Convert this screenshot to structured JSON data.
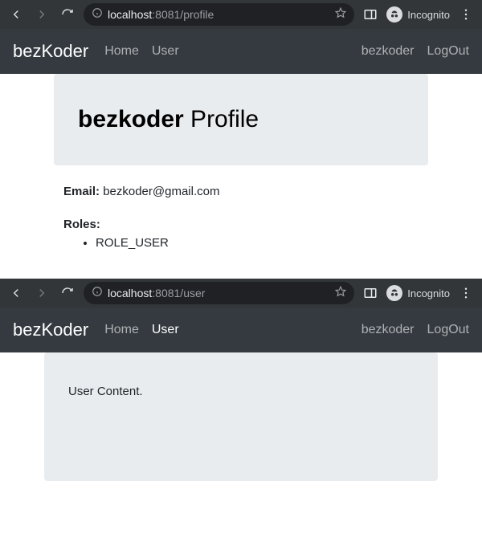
{
  "top": {
    "url_host": "localhost",
    "url_rest": ":8081/profile",
    "incognito_label": "Incognito",
    "navbar": {
      "brand": "bezKoder",
      "home": "Home",
      "user": "User",
      "username": "bezkoder",
      "logout": "LogOut"
    },
    "profile": {
      "username_bold": "bezkoder",
      "title_rest": " Profile",
      "email_label": "Email:",
      "email_value": "bezkoder@gmail.com",
      "roles_label": "Roles:",
      "roles": [
        "ROLE_USER"
      ]
    }
  },
  "bottom": {
    "url_host": "localhost",
    "url_rest": ":8081/user",
    "incognito_label": "Incognito",
    "navbar": {
      "brand": "bezKoder",
      "home": "Home",
      "user": "User",
      "username": "bezkoder",
      "logout": "LogOut"
    },
    "page": {
      "content": "User Content."
    }
  }
}
